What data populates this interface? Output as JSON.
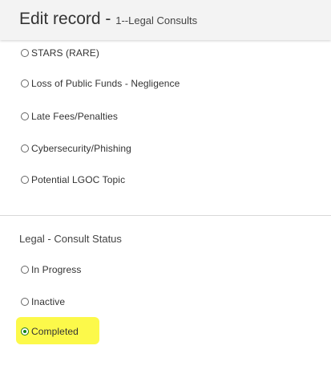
{
  "header": {
    "title": "Edit record - ",
    "subtitle": "1--Legal Consults"
  },
  "topic_options": [
    {
      "label": "STARS (RARE)",
      "selected": false
    },
    {
      "label": "Loss of Public Funds - Negligence",
      "selected": false
    },
    {
      "label": "Late Fees/Penalties",
      "selected": false
    },
    {
      "label": "Cybersecurity/Phishing",
      "selected": false
    },
    {
      "label": "Potential LGOC Topic",
      "selected": false
    }
  ],
  "consult_status": {
    "label": "Legal - Consult Status",
    "options": [
      {
        "label": "In Progress",
        "selected": false
      },
      {
        "label": "Inactive",
        "selected": false
      },
      {
        "label": "Completed",
        "selected": true
      }
    ]
  },
  "colors": {
    "highlight": "#fcf94a",
    "selected_radio": "#148514",
    "header_bg": "#f3f3f3"
  }
}
